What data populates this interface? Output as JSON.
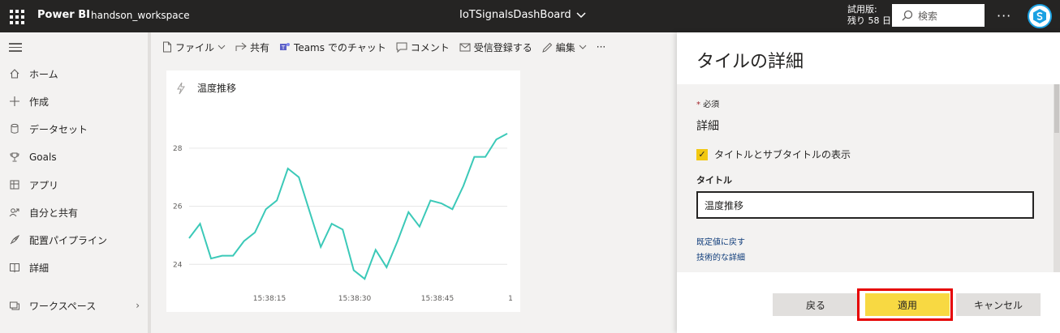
{
  "topbar": {
    "brand": "Power BI",
    "workspace": "handson_workspace",
    "report_title": "IoTSignalsDashBoard",
    "trial_line1": "試用版:",
    "trial_line2": "残り 58 日",
    "search_placeholder": "検索",
    "more": "···"
  },
  "nav": {
    "items": [
      {
        "label": "ホーム",
        "icon": "home-icon"
      },
      {
        "label": "作成",
        "icon": "plus-icon"
      },
      {
        "label": "データセット",
        "icon": "database-icon"
      },
      {
        "label": "Goals",
        "icon": "trophy-icon"
      },
      {
        "label": "アプリ",
        "icon": "apps-icon"
      },
      {
        "label": "自分と共有",
        "icon": "shared-icon"
      },
      {
        "label": "配置パイプライン",
        "icon": "rocket-icon"
      },
      {
        "label": "詳細",
        "icon": "book-icon"
      },
      {
        "label": "ワークスペース",
        "icon": "workspace-icon"
      }
    ]
  },
  "commands": {
    "file": "ファイル",
    "share": "共有",
    "teams": "Teams でのチャット",
    "comment": "コメント",
    "subscribe": "受信登録する",
    "edit": "編集",
    "more": "···"
  },
  "tile": {
    "title": "温度推移"
  },
  "chart_data": {
    "type": "line",
    "title": "温度推移",
    "xlabel": "",
    "ylabel": "",
    "y_ticks": [
      24,
      26,
      28
    ],
    "ylim": [
      23.2,
      29.0
    ],
    "x_tick_labels": [
      "15:38:15",
      "15:38:30",
      "15:38:45",
      "1"
    ],
    "series": [
      {
        "color": "#3bc9b8",
        "values": [
          24.9,
          25.4,
          24.2,
          24.3,
          24.3,
          24.8,
          25.1,
          25.9,
          26.2,
          27.3,
          27.0,
          25.8,
          24.6,
          25.4,
          25.2,
          23.8,
          23.5,
          24.5,
          23.9,
          24.8,
          25.8,
          25.3,
          26.2,
          26.1,
          25.9,
          26.7,
          27.7,
          27.7,
          28.3,
          28.5
        ]
      }
    ],
    "grid": true
  },
  "panel": {
    "title": "タイルの詳細",
    "required_star": "*",
    "required": "必須",
    "section": "詳細",
    "checkbox_label": "タイトルとサブタイトルの表示",
    "title_field_label": "タイトル",
    "title_value": "温度推移",
    "link_restore": "既定値に戻す",
    "link_tech": "技術的な詳細",
    "btn_back": "戻る",
    "btn_apply": "適用",
    "btn_cancel": "キャンセル"
  },
  "colors": {
    "accent": "#f2c811",
    "topbar": "#252423",
    "line": "#3bc9b8",
    "highlight": "#e60000"
  }
}
